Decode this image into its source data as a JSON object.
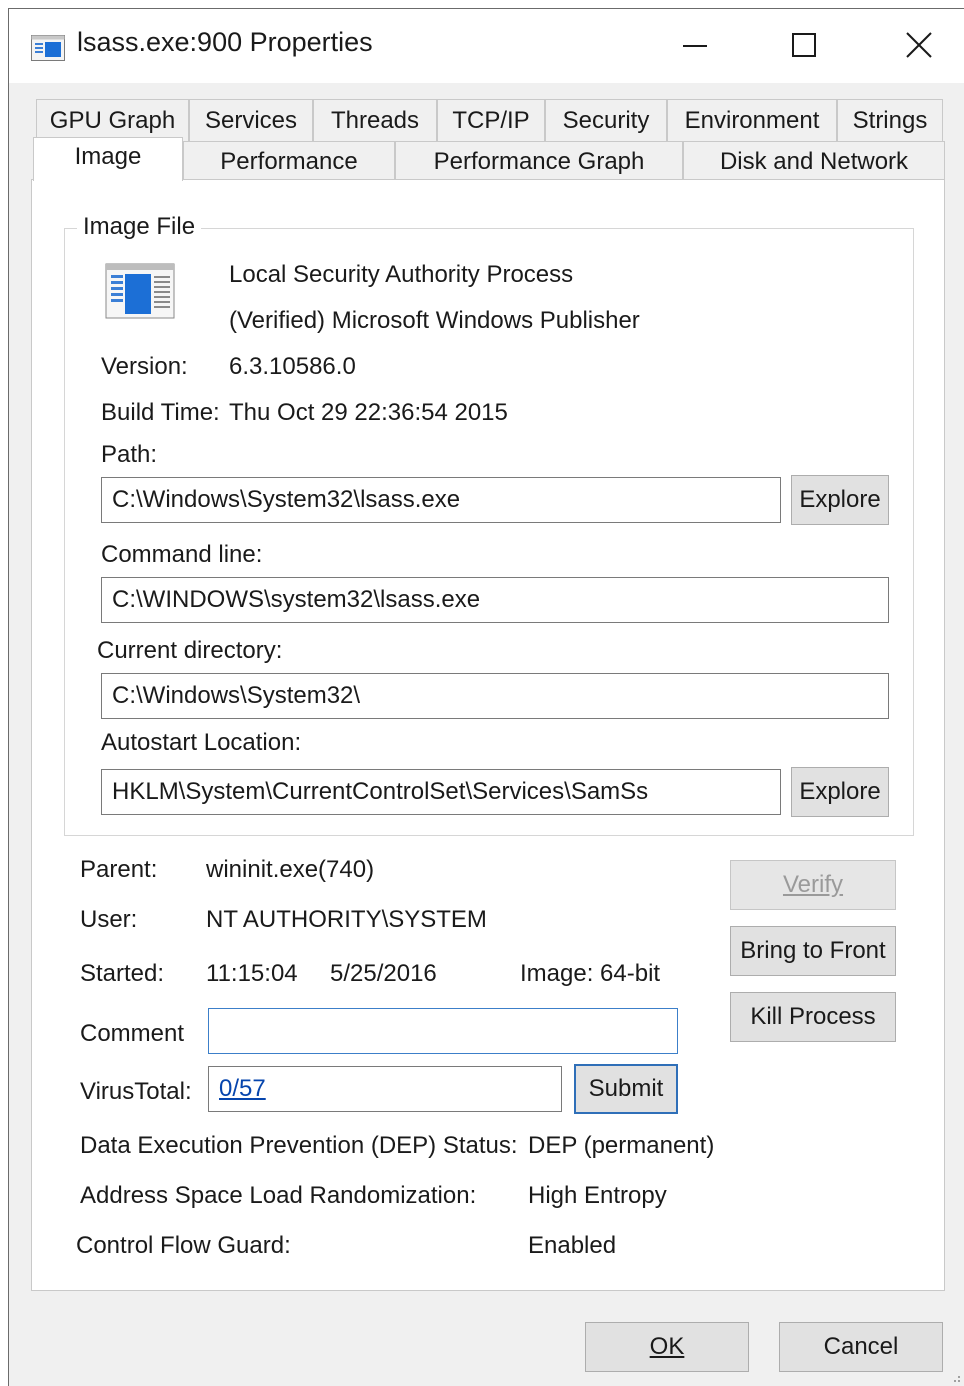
{
  "window": {
    "title": "lsass.exe:900 Properties"
  },
  "tabs_row1": [
    "GPU Graph",
    "Services",
    "Threads",
    "TCP/IP",
    "Security",
    "Environment",
    "Strings"
  ],
  "tabs_row2": [
    "Image",
    "Performance",
    "Performance Graph",
    "Disk and Network"
  ],
  "image_file": {
    "group_label": "Image File",
    "description": "Local Security Authority Process",
    "publisher": "(Verified) Microsoft Windows Publisher",
    "version_label": "Version:",
    "version_value": "6.3.10586.0",
    "build_time_label": "Build Time:",
    "build_time_value": "Thu Oct 29 22:36:54 2015",
    "path_label": "Path:",
    "path_value": "C:\\Windows\\System32\\lsass.exe",
    "explore_label": "Explore",
    "command_line_label": "Command line:",
    "command_line_value": "C:\\WINDOWS\\system32\\lsass.exe",
    "current_dir_label": "Current directory:",
    "current_dir_value": "C:\\Windows\\System32\\",
    "autostart_label": "Autostart Location:",
    "autostart_value": "HKLM\\System\\CurrentControlSet\\Services\\SamSs"
  },
  "process": {
    "parent_label": "Parent:",
    "parent_value": "wininit.exe(740)",
    "user_label": "User:",
    "user_value": "NT AUTHORITY\\SYSTEM",
    "started_label": "Started:",
    "started_time": "11:15:04",
    "started_date": "5/25/2016",
    "image_label": "Image: 64-bit",
    "comment_label": "Comment",
    "comment_value": "",
    "virustotal_label": "VirusTotal:",
    "virustotal_value": "0/57",
    "submit_label": "Submit",
    "verify_label": "Verify",
    "bring_to_front_label": "Bring to Front",
    "kill_process_label": "Kill Process",
    "dep_label": "Data Execution Prevention (DEP) Status:",
    "dep_value": "DEP (permanent)",
    "aslr_label": "Address Space Load Randomization:",
    "aslr_value": "High Entropy",
    "cfg_label": "Control Flow Guard:",
    "cfg_value": "Enabled"
  },
  "footer": {
    "ok_label": "OK",
    "cancel_label": "Cancel"
  },
  "colors": {
    "dialog_bg": "#f0f0f0",
    "link": "#0645ad",
    "focus_border": "#2f6fb8"
  }
}
